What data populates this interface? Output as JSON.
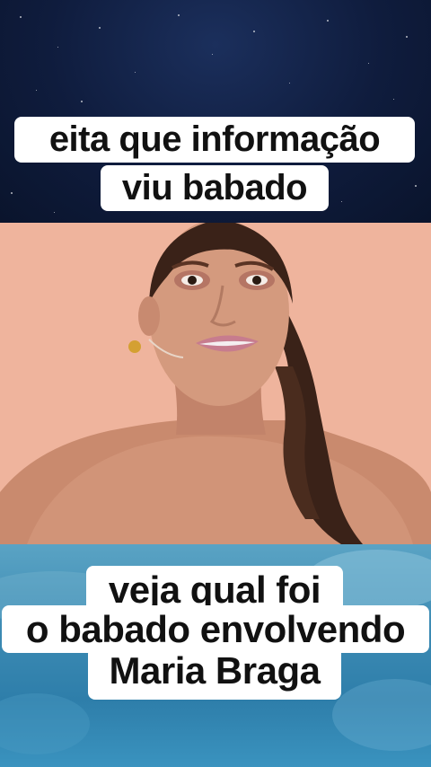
{
  "captions": {
    "top_line1": "eita que informação",
    "top_line2": "viu babado",
    "bottom_line1": "veja qual foi",
    "bottom_line2": "o babado envolvendo",
    "bottom_line3": "Maria Braga"
  },
  "colors": {
    "caption_background": "#ffffff",
    "caption_text": "#111111",
    "top_background": "#0f1c3d",
    "video_background": "#eeb09a",
    "bottom_background": "#3b8ab3"
  }
}
